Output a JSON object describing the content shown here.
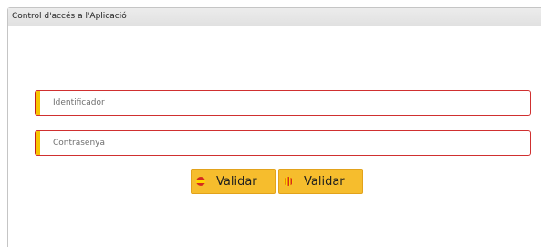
{
  "panel": {
    "title": "Control d'accés a l'Aplicació"
  },
  "form": {
    "identifier_placeholder": "Identificador",
    "password_placeholder": "Contrasenya"
  },
  "buttons": [
    {
      "label": "Validar",
      "flag": "spain-flag-icon"
    },
    {
      "label": "Validar",
      "flag": "catalonia-flag-icon"
    }
  ],
  "colors": {
    "accent_yellow": "#f6bd2d",
    "accent_red": "#c41c1c",
    "field_border": "#d03030"
  }
}
